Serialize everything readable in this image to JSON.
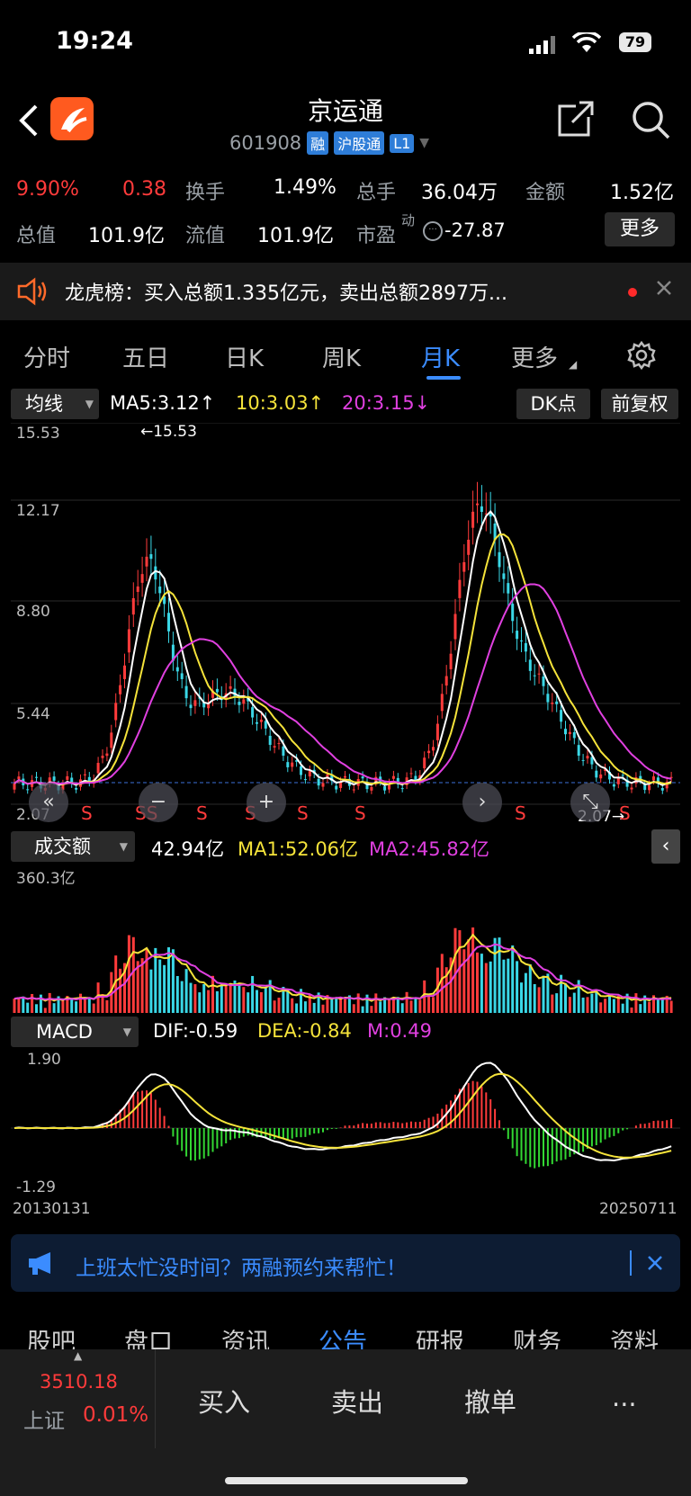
{
  "status": {
    "time": "19:24",
    "battery": "79"
  },
  "header": {
    "title": "京运通",
    "code": "601908",
    "tags": [
      "融",
      "沪股通",
      "L1"
    ]
  },
  "quote": {
    "pct": "9.90%",
    "change": "0.38",
    "turnover_label": "换手",
    "turnover": "1.49%",
    "volume_label": "总手",
    "volume": "36.04万",
    "amount_label": "金额",
    "amount": "1.52亿",
    "mcap_label": "总值",
    "mcap": "101.9亿",
    "float_label": "流值",
    "float": "101.9亿",
    "pe_label": "市盈",
    "pe_sup": "动",
    "pe": "-27.87",
    "more": "更多"
  },
  "banner": {
    "text": "龙虎榜：买入总额1.335亿元，卖出总额2897万..."
  },
  "tabs": [
    "分时",
    "五日",
    "日K",
    "周K",
    "月K",
    "更多"
  ],
  "active_tab": "月K",
  "kline": {
    "ma_selector": "均线",
    "ma5": "MA5:3.12↑",
    "ma10": "10:3.03↑",
    "ma20": "20:3.15↓",
    "dk_button": "DK点",
    "adjust_button": "前复权",
    "y_labels": [
      "15.53",
      "12.17",
      "8.80",
      "5.44",
      "2.07"
    ],
    "high_marker": "←15.53",
    "low_marker": "2.07→",
    "signals": [
      "S",
      "SS",
      "S",
      "S",
      "S",
      "S",
      "S",
      "S"
    ]
  },
  "volume": {
    "selector": "成交额",
    "value": "42.94亿",
    "ma1": "MA1:52.06亿",
    "ma2": "MA2:45.82亿",
    "top": "360.3亿"
  },
  "macd": {
    "selector": "MACD",
    "dif": "DIF:-0.59",
    "dea": "DEA:-0.84",
    "m": "M:0.49",
    "top": "1.90",
    "bottom": "-1.29",
    "date_start": "20130131",
    "date_end": "20250711"
  },
  "promo": {
    "text": "上班太忙没时间？两融预约来帮忙！"
  },
  "bottom_tabs": [
    "股吧",
    "盘口",
    "资讯",
    "公告",
    "研报",
    "财务",
    "资料"
  ],
  "active_bottom_tab": "公告",
  "index": {
    "value": "3510.18",
    "name": "上证",
    "pct": "0.01%"
  },
  "actions": {
    "buy": "买入",
    "sell": "卖出",
    "cancel": "撤单",
    "more": "..."
  },
  "colors": {
    "up": "#ff3b3b",
    "down": "#3ad7e6",
    "ma5": "#ffffff",
    "ma10": "#f5e33a",
    "ma20": "#e040e0",
    "accent": "#3b8cff"
  }
}
